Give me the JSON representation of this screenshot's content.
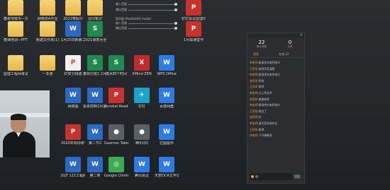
{
  "desktop": {
    "icons": [
      {
        "id": "r0c0",
        "label": "春考地级市—文档版",
        "type": "folder"
      },
      {
        "id": "r0c1",
        "label": "网络流A作业",
        "type": "folder"
      },
      {
        "id": "r0c2",
        "label": "2021寒假计",
        "type": "folder"
      },
      {
        "id": "r0c3",
        "label": "合同笔记",
        "type": "folder"
      },
      {
        "id": "r1c0",
        "label": "春课培训—PPT",
        "type": "folder"
      },
      {
        "id": "r1c1",
        "label": "新建文件夹(1)",
        "type": "folder"
      },
      {
        "id": "r1c2",
        "label": "1月25日新第二版",
        "type": "word"
      },
      {
        "id": "r1c3",
        "label": "2021课表大全",
        "type": "excel"
      },
      {
        "id": "r2c0",
        "label": "监理工程师考试通表",
        "type": "folder"
      },
      {
        "id": "r2c1",
        "label": "一本通",
        "type": "folder"
      },
      {
        "id": "r2c2",
        "label": "红安分班级",
        "type": "doc-white"
      },
      {
        "id": "r2c3",
        "label": "秦剑分班1.2月份通表",
        "type": "excel"
      },
      {
        "id": "r2c4",
        "label": "流水四个时间",
        "type": "excel"
      },
      {
        "id": "r2c5",
        "label": "XMind ZEN",
        "type": "app-red"
      },
      {
        "id": "r2c6",
        "label": "WPS Office",
        "type": "app-blue"
      },
      {
        "id": "r3c2",
        "label": "网络图",
        "type": "word"
      },
      {
        "id": "r3c3",
        "label": "投资控制2月通表",
        "type": "word"
      },
      {
        "id": "r3c4",
        "label": "Acrobat Reader DC",
        "type": "pdf"
      },
      {
        "id": "r3c5",
        "label": "钉钉",
        "type": "app-teal"
      },
      {
        "id": "r3c6",
        "label": "百度网盘",
        "type": "app-blue"
      },
      {
        "id": "r4c2",
        "label": "2020年现场考有问题",
        "type": "pdf"
      },
      {
        "id": "r4c3",
        "label": "第二节2",
        "type": "word"
      },
      {
        "id": "r4c4",
        "label": "Gaomon Tablet",
        "type": "app-gray"
      },
      {
        "id": "r4c5",
        "label": "腾讯QQ",
        "type": "app-gray"
      },
      {
        "id": "r4c6",
        "label": "亿图图示",
        "type": "app-blue"
      },
      {
        "id": "r5c2",
        "label": "JGJT 121工程网络",
        "type": "word"
      },
      {
        "id": "r5c3",
        "label": "第二章",
        "type": "word"
      },
      {
        "id": "r5c4",
        "label": "Google Chrome",
        "type": "app-green"
      },
      {
        "id": "r5c5",
        "label": "腾讯会议",
        "type": "app-blue"
      },
      {
        "id": "r5c6",
        "label": "天若OCR文字识别",
        "type": "app-blue"
      },
      {
        "id": "r0c7",
        "label": "钉钉会议监理VIP作业",
        "type": "pdf"
      },
      {
        "id": "r1c7",
        "label": "1月需课堂作",
        "type": "pdf"
      }
    ]
  },
  "mixer": {
    "rows": [
      "输入音量",
      "输出音量",
      "",
      "输入音量",
      "输出音量"
    ],
    "device_title": "扬声器 (Realtek(R) Audio)"
  },
  "chat_panel": {
    "stats": [
      {
        "num": "22",
        "cap": "累计观看"
      },
      {
        "num": "0",
        "cap": "点赞"
      }
    ],
    "tabs": [
      "消息",
      "在线 22"
    ],
    "messages": [
      {
        "name": "李老师:",
        "body": "收录完毕老师讲义"
      },
      {
        "name": "王同学:",
        "body": "老师声音清楚"
      },
      {
        "name": "李老师:",
        "body": "收录完毕老师讲义"
      },
      {
        "name": "张同学:",
        "body": "好的"
      },
      {
        "name": "王同学:",
        "body": "收到"
      },
      {
        "name": "李老师:",
        "body": "已上传文件"
      },
      {
        "name": "张同学:",
        "body": "谢谢老师"
      },
      {
        "name": "李老师:",
        "body": "收录完毕老师讲义"
      },
      {
        "name": "王同学:",
        "body": "明白了"
      },
      {
        "name": "张同学:",
        "body": "好"
      },
      {
        "name": "李老师:",
        "body": "请大家完成作业"
      },
      {
        "name": "王同学:",
        "body": "收到"
      },
      {
        "name": "李老师:",
        "body": "下节课继续"
      }
    ],
    "send_label": "发送"
  }
}
